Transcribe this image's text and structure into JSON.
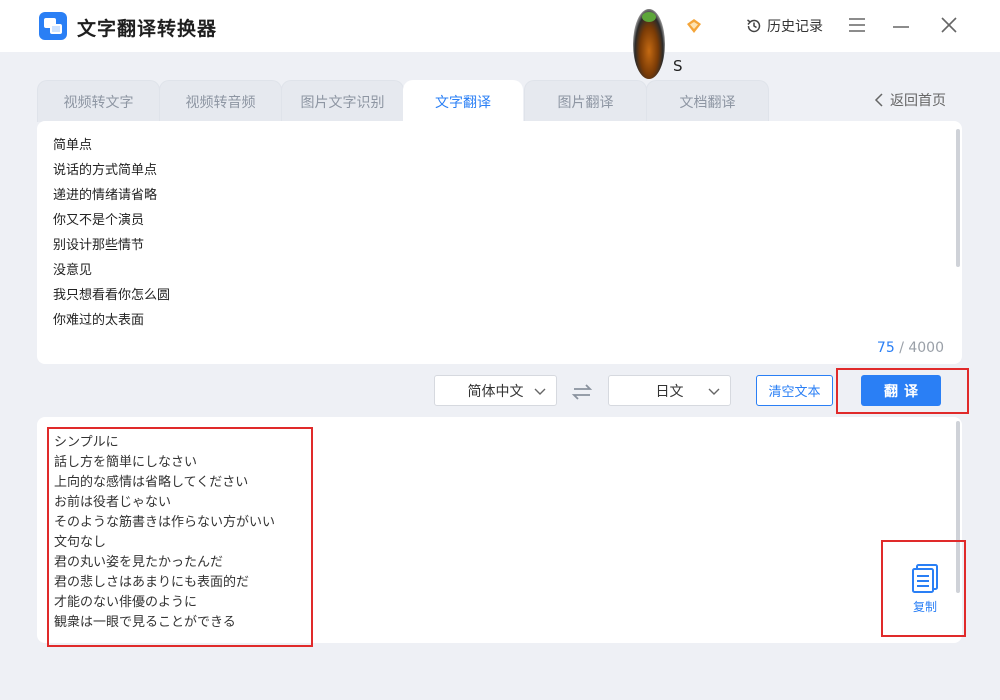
{
  "app": {
    "title": "文字翻译转换器"
  },
  "user": {
    "name": "S"
  },
  "header": {
    "history_label": "历史记录"
  },
  "tabs": [
    {
      "label": "视频转文字",
      "active": false
    },
    {
      "label": "视频转音频",
      "active": false
    },
    {
      "label": "图片文字识别",
      "active": false
    },
    {
      "label": "文字翻译",
      "active": true
    },
    {
      "label": "图片翻译",
      "active": false
    },
    {
      "label": "文档翻译",
      "active": false
    }
  ],
  "nav": {
    "back_home": "返回首页"
  },
  "input": {
    "lines": [
      "简单点",
      "说话的方式简单点",
      "递进的情绪请省略",
      "你又不是个演员",
      "别设计那些情节",
      "没意见",
      "我只想看看你怎么圆",
      "你难过的太表面"
    ],
    "count": "75",
    "max": "/ 4000"
  },
  "controls": {
    "source_lang": "简体中文",
    "target_lang": "日文",
    "clear_label": "清空文本",
    "translate_label": "翻译"
  },
  "output": {
    "lines": [
      "シンプルに",
      "話し方を簡単にしなさい",
      "上向的な感情は省略してください",
      "お前は役者じゃない",
      "そのような筋書きは作らない方がいい",
      "文句なし",
      "君の丸い姿を見たかったんだ",
      "君の悲しさはあまりにも表面的だ",
      "才能のない俳優のように",
      "観衆は一眼で見ることができる"
    ],
    "copy_label": "复制"
  },
  "colors": {
    "accent": "#2a7ff5",
    "highlight": "#e02a2a",
    "background": "#eef0f5"
  }
}
